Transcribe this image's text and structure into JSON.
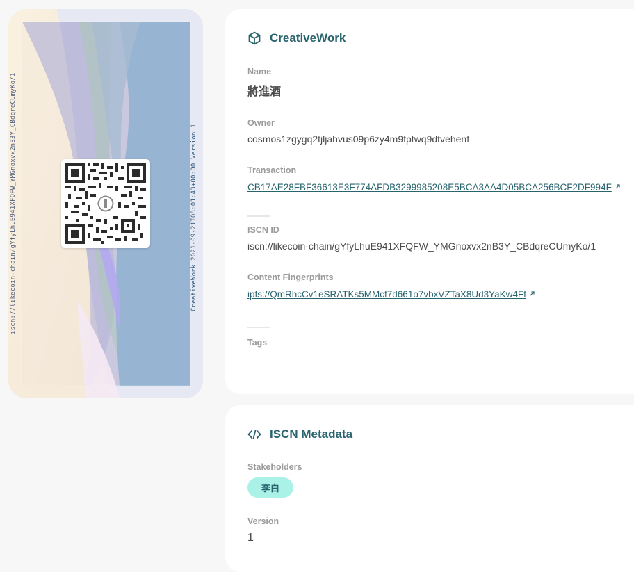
{
  "card": {
    "left_text": "iscn://likecoin-chain/gYfyLhuE941XFQFW_YMGnoxvx2nB3Y_CBdqreCUmyKo/1",
    "right_text": "CreativeWork 2021-09-21T08:01:43+00:00 Version 1"
  },
  "creative_work": {
    "title": "CreativeWork",
    "name_label": "Name",
    "name_value": "將進酒",
    "owner_label": "Owner",
    "owner_value": "cosmos1zgygq2tjljahvus09p6zy4m9fptwq9dtvehenf",
    "transaction_label": "Transaction",
    "transaction_value": "CB17AE28FBF36613E3F774AFDB3299985208E5BCA3AA4D05BCA256BCF2DF994F",
    "iscn_id_label": "ISCN ID",
    "iscn_id_value": "iscn://likecoin-chain/gYfyLhuE941XFQFW_YMGnoxvx2nB3Y_CBdqreCUmyKo/1",
    "fingerprints_label": "Content Fingerprints",
    "fingerprint_value": "ipfs://QmRhcCv1eSRATKs5MMcf7d661o7vbxVZTaX8Ud3YaKw4Ff",
    "tags_label": "Tags"
  },
  "metadata": {
    "title": "ISCN Metadata",
    "stakeholders_label": "Stakeholders",
    "stakeholders": [
      "李白"
    ],
    "version_label": "Version",
    "version_value": "1"
  },
  "colors": {
    "accent": "#28646e",
    "badge_bg": "#aaf1e7",
    "page_bg": "#f7f7f7"
  },
  "icons": {
    "creative_work": "cube-icon",
    "metadata": "code-icon",
    "external": "external-link-icon"
  }
}
